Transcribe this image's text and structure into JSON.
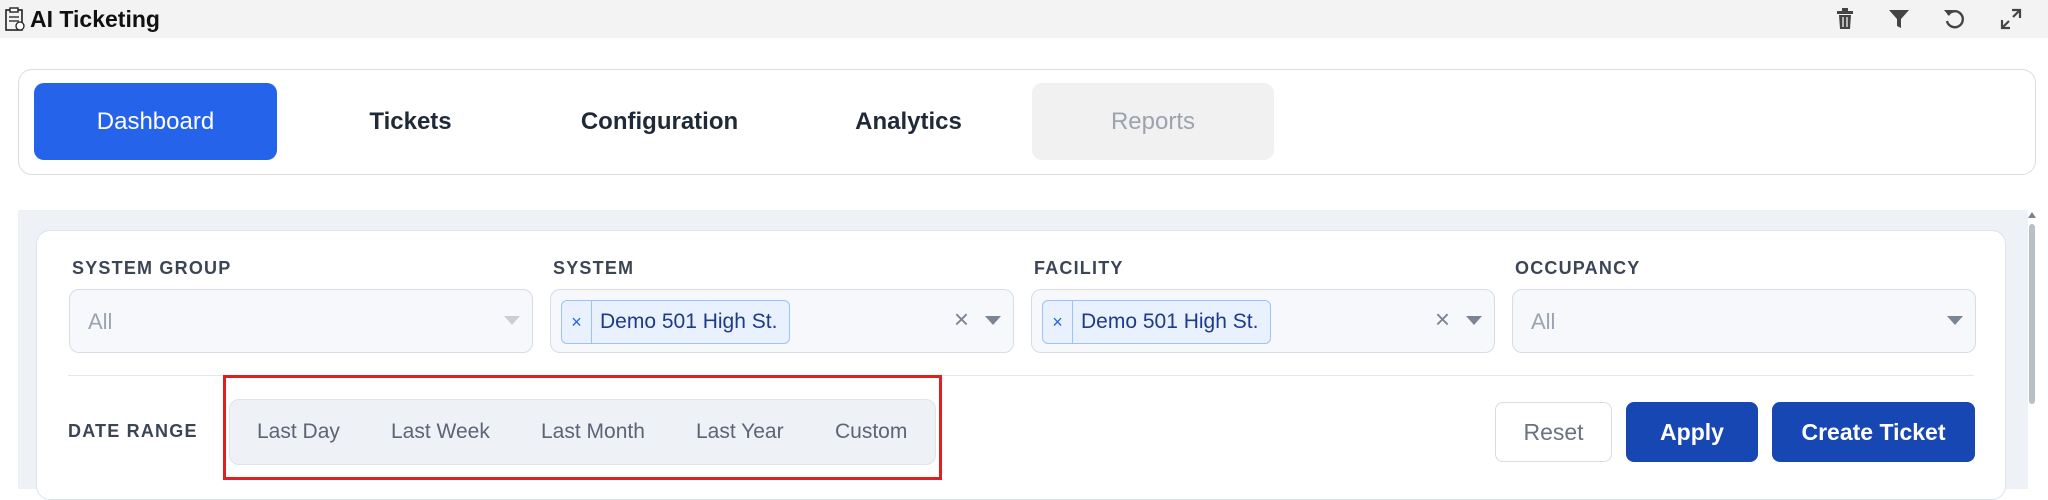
{
  "window": {
    "title": "AI Ticketing"
  },
  "toolbar": {
    "icons": [
      "trash-icon",
      "filter-icon",
      "refresh-icon",
      "expand-icon"
    ]
  },
  "tabs": [
    {
      "label": "Dashboard",
      "state": "active"
    },
    {
      "label": "Tickets",
      "state": "normal"
    },
    {
      "label": "Configuration",
      "state": "normal"
    },
    {
      "label": "Analytics",
      "state": "normal"
    },
    {
      "label": "Reports",
      "state": "disabled"
    }
  ],
  "filters": {
    "system_group": {
      "label": "SYSTEM GROUP",
      "placeholder": "All"
    },
    "system": {
      "label": "SYSTEM",
      "chip": "Demo 501 High St.",
      "chip_remove": "×",
      "clear": "×"
    },
    "facility": {
      "label": "FACILITY",
      "chip": "Demo 501 High St.",
      "chip_remove": "×",
      "clear": "×"
    },
    "occupancy": {
      "label": "OCCUPANCY",
      "placeholder": "All"
    }
  },
  "date_range": {
    "label": "DATE RANGE",
    "options": [
      "Last Day",
      "Last Week",
      "Last Month",
      "Last Year",
      "Custom"
    ]
  },
  "actions": {
    "reset": "Reset",
    "apply": "Apply",
    "create": "Create Ticket"
  },
  "colors": {
    "accent": "#2563eb",
    "primary_button": "#1747b3",
    "highlight_box": "#e02020"
  }
}
